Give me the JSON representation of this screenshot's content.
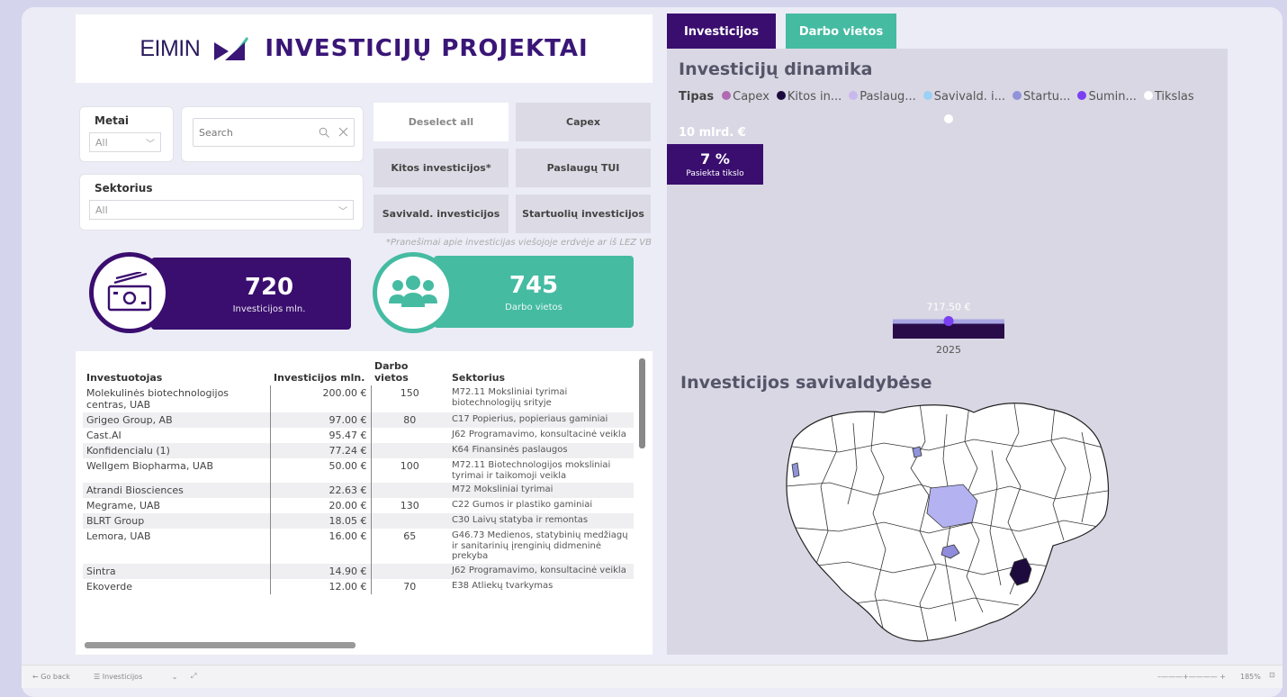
{
  "header": {
    "logo_text": "EIMIN",
    "title": "INVESTICIJŲ PROJEKTAI"
  },
  "filters": {
    "year_label": "Metai",
    "year_value": "All",
    "search_placeholder": "Search",
    "sector_label": "Sektorius",
    "sector_value": "All"
  },
  "buttons": {
    "deselect": "Deselect all",
    "capex": "Capex",
    "other": "Kitos investicijos*",
    "services": "Paslaugų TUI",
    "municipal": "Savivald. investicijos",
    "startups": "Startuolių investicijos"
  },
  "note": "*Pranešimai apie investicijas viešojoje erdvėje ar iš LEZ VB",
  "kpis": {
    "investment_value": "720",
    "investment_label": "Investicijos mln.",
    "jobs_value": "745",
    "jobs_label": "Darbo vietos"
  },
  "table": {
    "headers": [
      "Investuotojas",
      "Investicijos mln.",
      "Darbo vietos",
      "Sektorius"
    ],
    "rows": [
      {
        "investor": "Molekulinės biotechnologijos centras, UAB",
        "inv": "200.00 €",
        "jobs": "150",
        "sector": "M72.11 Moksliniai tyrimai biotechnologijų srityje"
      },
      {
        "investor": "Grigeo Group, AB",
        "inv": "97.00 €",
        "jobs": "80",
        "sector": "C17 Popierius, popieriaus gaminiai"
      },
      {
        "investor": "Cast.AI",
        "inv": "95.47 €",
        "jobs": "",
        "sector": "J62 Programavimo, konsultacinė veikla"
      },
      {
        "investor": "Konfidencialu (1)",
        "inv": "77.24 €",
        "jobs": "",
        "sector": "K64 Finansinės paslaugos"
      },
      {
        "investor": "Wellgem Biopharma, UAB",
        "inv": "50.00 €",
        "jobs": "100",
        "sector": "M72.11 Biotechnologijos moksliniai tyrimai ir taikomoji veikla"
      },
      {
        "investor": "Atrandi Biosciences",
        "inv": "22.63 €",
        "jobs": "",
        "sector": "M72 Moksliniai tyrimai"
      },
      {
        "investor": "Megrame, UAB",
        "inv": "20.00 €",
        "jobs": "130",
        "sector": "C22 Gumos ir plastiko gaminiai"
      },
      {
        "investor": "BLRT Group",
        "inv": "18.05 €",
        "jobs": "",
        "sector": "C30 Laivų statyba ir remontas"
      },
      {
        "investor": "Lemora, UAB",
        "inv": "16.00 €",
        "jobs": "65",
        "sector": "G46.73 Medienos, statybinių medžiagų ir sanitarinių įrenginių didmeninė prekyba"
      },
      {
        "investor": "Sintra",
        "inv": "14.90 €",
        "jobs": "",
        "sector": "J62 Programavimo, konsultacinė veikla"
      },
      {
        "investor": "Ekoverde",
        "inv": "12.00 €",
        "jobs": "70",
        "sector": "E38 Atliekų tvarkymas"
      }
    ]
  },
  "tabs": {
    "investments": "Investicijos",
    "jobs": "Darbo vietos"
  },
  "dynamics": {
    "title": "Investicijų dinamika",
    "legend_title": "Tipas",
    "legend": [
      {
        "label": "Capex",
        "color": "#b06ab3"
      },
      {
        "label": "Kitos in...",
        "color": "#1e0b3e"
      },
      {
        "label": "Paslaug...",
        "color": "#c9b8ee"
      },
      {
        "label": "Savivald. i...",
        "color": "#9cd0f5"
      },
      {
        "label": "Startu...",
        "color": "#8f93d8"
      },
      {
        "label": "Sumin...",
        "color": "#7b3ff2"
      },
      {
        "label": "Tikslas",
        "color": "#ffffff"
      }
    ],
    "target_label": "10 mlrd. €",
    "percent": "7 %",
    "percent_label": "Pasiekta tikslo",
    "bar_value_label": "717.50 €",
    "year": "2025"
  },
  "chart_data": {
    "type": "bar",
    "categories": [
      "2025"
    ],
    "series": [
      {
        "name": "Sumin...",
        "values": [
          717.5
        ]
      },
      {
        "name": "Tikslas",
        "values": [
          10000
        ]
      }
    ],
    "title": "Investicijų dinamika",
    "data_labels": [
      "717.50 €"
    ],
    "target_label": "10 mlrd. €"
  },
  "map": {
    "title": "Investicijos savivaldybėse"
  },
  "bottom": {
    "back": "Go back",
    "page": "Investicijos",
    "zoom": "185%"
  },
  "colors": {
    "purple": "#3a0e6f",
    "teal": "#45bba2"
  }
}
